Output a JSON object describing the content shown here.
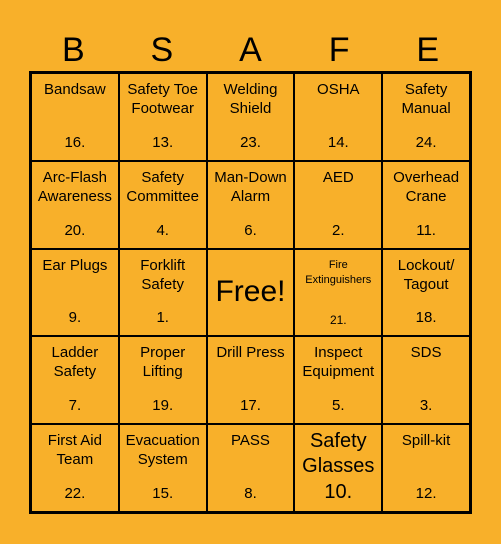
{
  "header": [
    "B",
    "S",
    "A",
    "F",
    "E"
  ],
  "cells": [
    {
      "label": "Bandsaw",
      "num": "16."
    },
    {
      "label": "Safety Toe Footwear",
      "num": "13."
    },
    {
      "label": "Welding Shield",
      "num": "23."
    },
    {
      "label": "OSHA",
      "num": "14."
    },
    {
      "label": "Safety Manual",
      "num": "24."
    },
    {
      "label": "Arc-Flash Awareness",
      "num": "20."
    },
    {
      "label": "Safety Committee",
      "num": "4."
    },
    {
      "label": "Man-Down Alarm",
      "num": "6."
    },
    {
      "label": "AED",
      "num": "2."
    },
    {
      "label": "Overhead Crane",
      "num": "11."
    },
    {
      "label": "Ear Plugs",
      "num": "9."
    },
    {
      "label": "Forklift Safety",
      "num": "1."
    },
    {
      "label": "Free!",
      "num": ""
    },
    {
      "label": "Fire Extinguishers",
      "num": "21."
    },
    {
      "label": "Lockout/ Tagout",
      "num": "18."
    },
    {
      "label": "Ladder Safety",
      "num": "7."
    },
    {
      "label": "Proper Lifting",
      "num": "19."
    },
    {
      "label": "Drill Press",
      "num": "17."
    },
    {
      "label": "Inspect Equipment",
      "num": "5."
    },
    {
      "label": "SDS",
      "num": "3."
    },
    {
      "label": "First Aid Team",
      "num": "22."
    },
    {
      "label": "Evacuation System",
      "num": "15."
    },
    {
      "label": "PASS",
      "num": "8."
    },
    {
      "label": "Safety Glasses",
      "num": "10."
    },
    {
      "label": "Spill-kit",
      "num": "12."
    }
  ]
}
